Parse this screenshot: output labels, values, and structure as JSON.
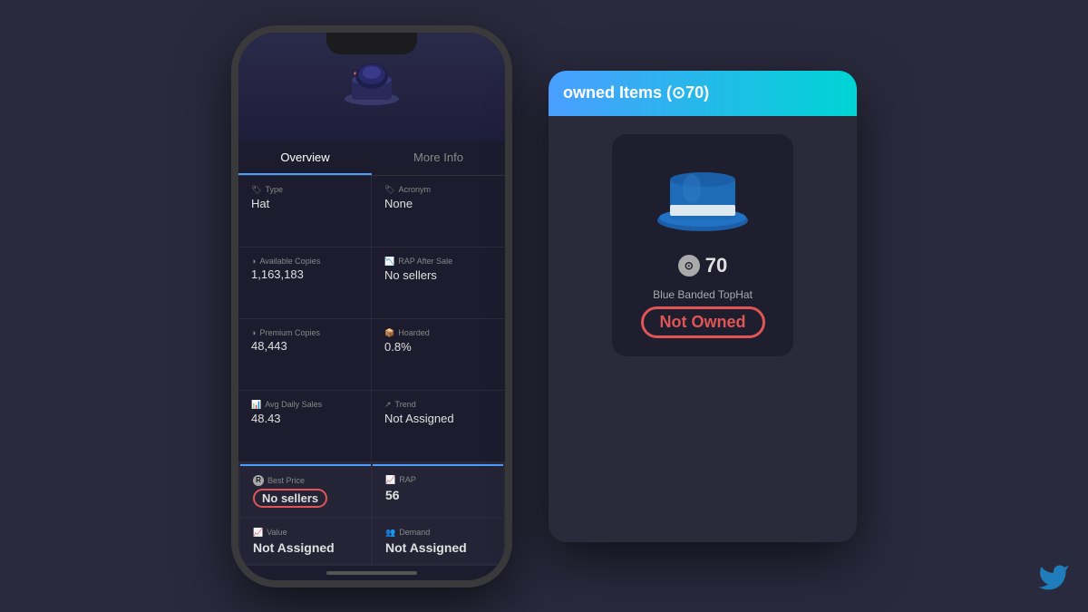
{
  "phone": {
    "tabs": [
      {
        "label": "Overview",
        "active": true
      },
      {
        "label": "More Info",
        "active": false
      }
    ],
    "info_items": [
      {
        "label": "Type",
        "icon": "tag",
        "value": "Hat"
      },
      {
        "label": "Acronym",
        "icon": "tag",
        "value": "None"
      },
      {
        "label": "Available Copies",
        "icon": "clock",
        "value": "1,163,183"
      },
      {
        "label": "RAP After Sale",
        "icon": "chart",
        "value": "No sellers"
      },
      {
        "label": "Premium Copies",
        "icon": "clock",
        "value": "48,443"
      },
      {
        "label": "Hoarded",
        "icon": "box",
        "value": "0.8%"
      },
      {
        "label": "Avg Daily Sales",
        "icon": "bar",
        "value": "48.43"
      },
      {
        "label": "Trend",
        "icon": "arrow",
        "value": "Not Assigned"
      }
    ],
    "best_price_label": "Best Price",
    "best_price_value": "No sellers",
    "rap_label": "RAP",
    "rap_value": "56",
    "value_label": "Value",
    "value_value": "Not Assigned",
    "demand_label": "Demand",
    "demand_value": "Not Assigned"
  },
  "right_panel": {
    "header_title": "owned Items (⊙70)",
    "robux_symbol": "⊙",
    "robux_amount": "70",
    "item_name": "Blue Banded TopHat",
    "not_owned_text": "Not Owned"
  }
}
